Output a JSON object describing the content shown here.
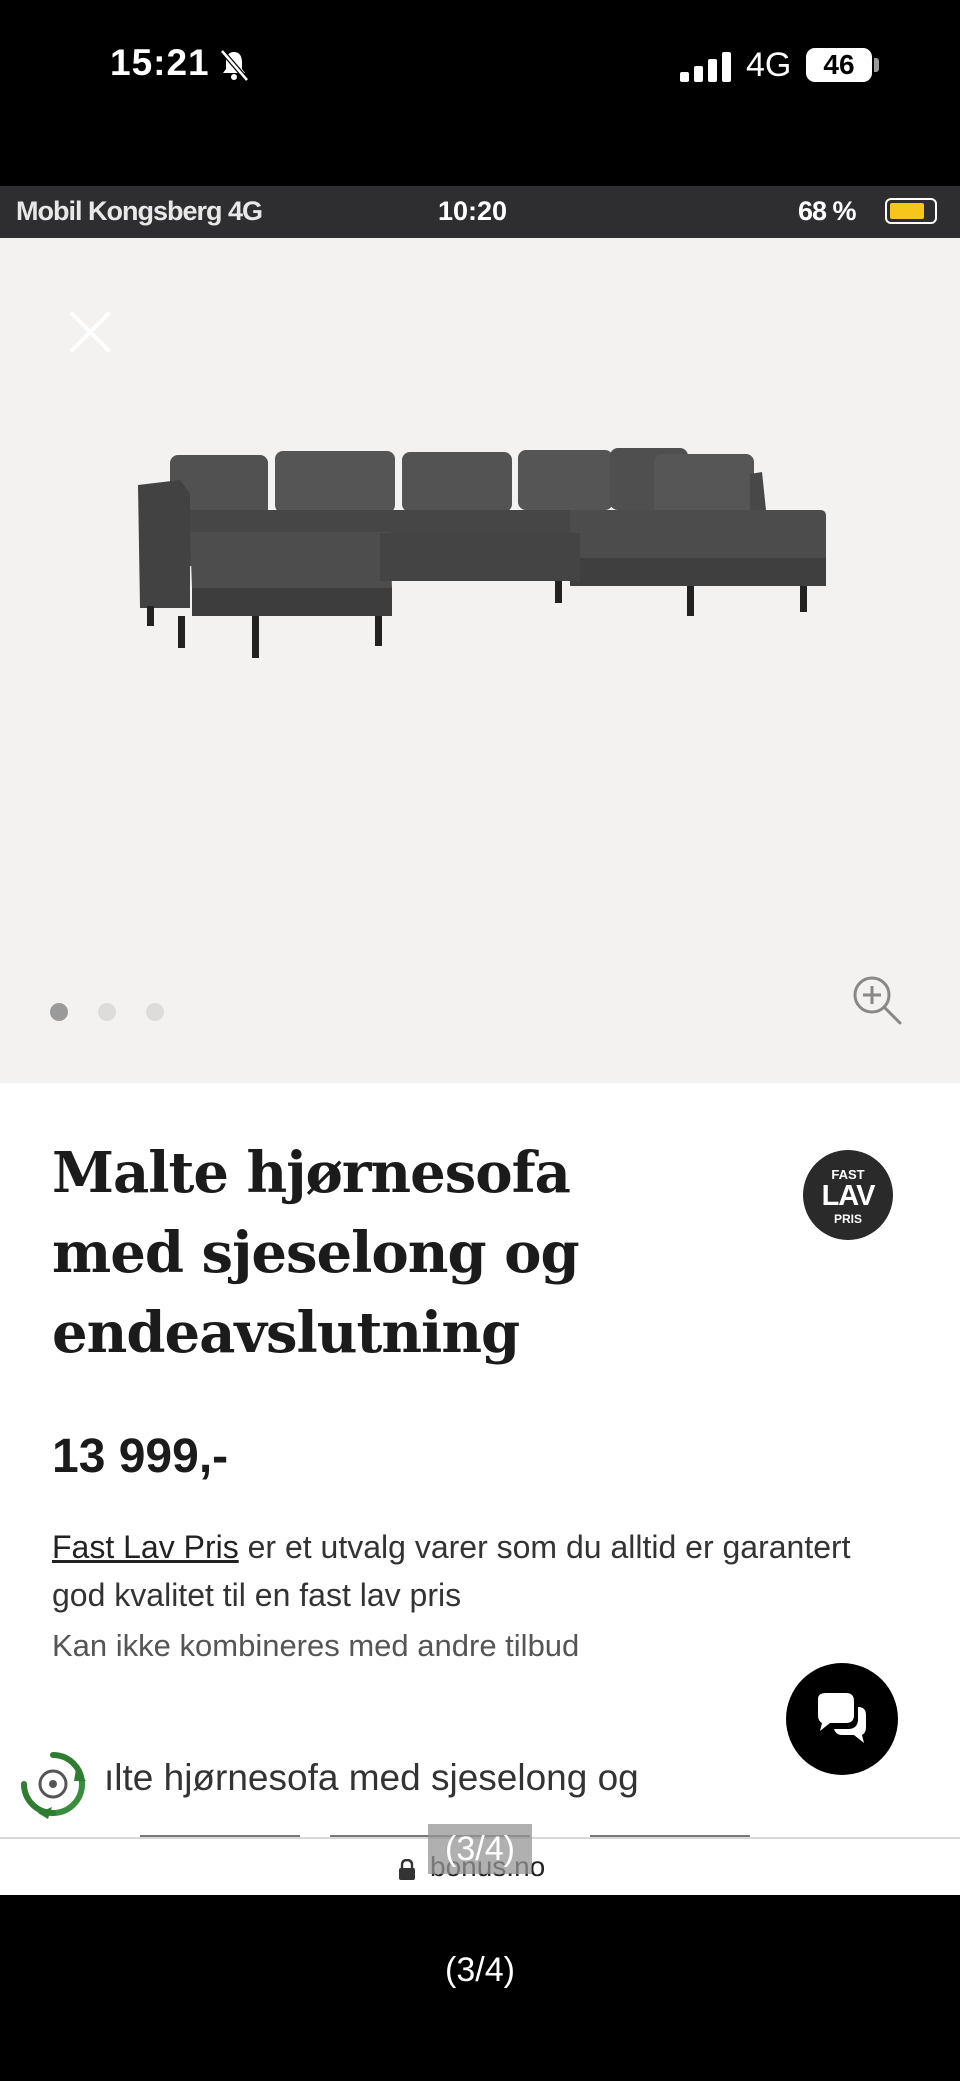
{
  "outer_status": {
    "time": "15:21",
    "network": "4G",
    "battery": "46"
  },
  "inner_status": {
    "left_text": "Mobil Kongsberg 4G",
    "time": "10:20",
    "battery_pct": "68 %"
  },
  "gallery": {
    "image_count": 3,
    "active_index": 0
  },
  "product": {
    "title": "Malte hjørnesofa med sjeselong og endeavslutning",
    "badge": {
      "top": "FAST",
      "mid": "LAV",
      "bottom": "PRIS"
    },
    "price": "13 999,-",
    "desc_link": "Fast Lav Pris",
    "desc_rest": " er et utvalg varer som du alltid er garantert god kvalitet til en fast lav pris",
    "sub_note": "Kan ikke kombineres med andre tilbud",
    "body_start": "ılte hjørnesofa med sjeselong og"
  },
  "browser": {
    "url": "bonus.no",
    "overlay_counter": "(3/4)"
  },
  "viewer": {
    "counter": "(3/4)"
  },
  "colors": {
    "dark": "#1b1b1b",
    "gallery_bg": "#f4f2f1",
    "sofa": "#4a4a4a",
    "eco_green": "#2e7d32",
    "battery_yellow": "#f6c61a"
  }
}
